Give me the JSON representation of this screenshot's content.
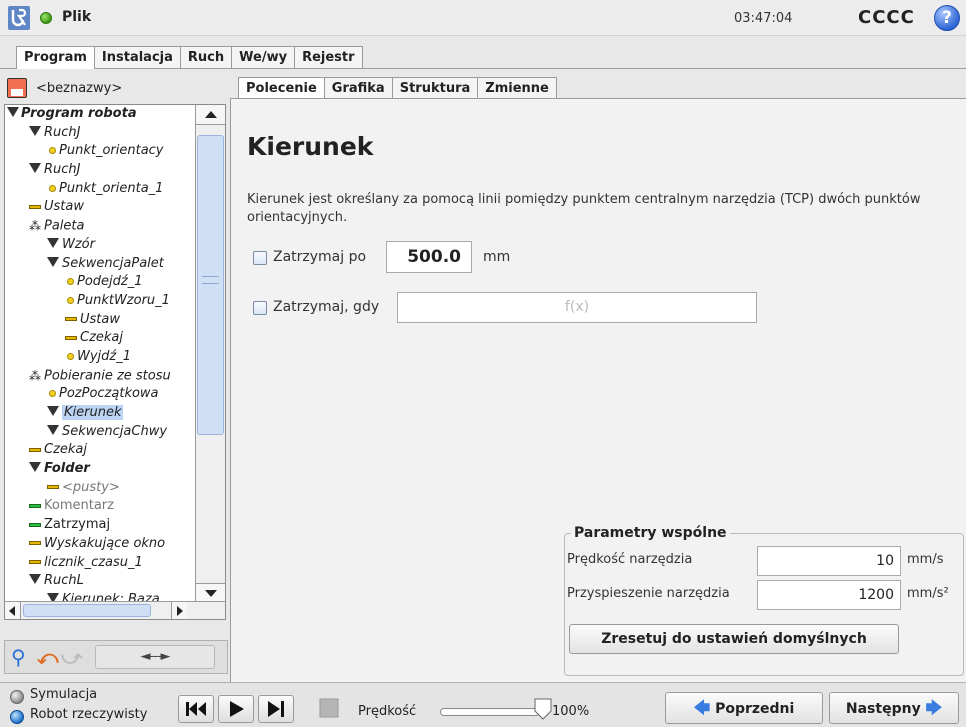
{
  "header": {
    "title": "Plik",
    "clock": "03:47:04",
    "robot_name": "CCCC",
    "help_symbol": "?"
  },
  "main_tabs": [
    "Program",
    "Instalacja",
    "Ruch",
    "We/wy",
    "Rejestr"
  ],
  "sub_tabs": [
    "Polecenie",
    "Grafika",
    "Struktura",
    "Zmienne"
  ],
  "left": {
    "file_name": "<beznazwy>",
    "tree": [
      {
        "label": "Program robota",
        "icon": "none",
        "indent": 0,
        "bold": true
      },
      {
        "label": "RuchJ",
        "icon": "triangle",
        "indent": 1
      },
      {
        "label": "Punkt_orientacy",
        "icon": "waypoint",
        "indent": 2
      },
      {
        "label": "RuchJ",
        "icon": "triangle",
        "indent": 1
      },
      {
        "label": "Punkt_orienta_1",
        "icon": "waypoint",
        "indent": 2
      },
      {
        "label": "Ustaw",
        "icon": "bar",
        "indent": 1
      },
      {
        "label": "Paleta",
        "icon": "pallet",
        "indent": 1
      },
      {
        "label": "Wzór",
        "icon": "triangle",
        "indent": 2
      },
      {
        "label": "SekwencjaPalet",
        "icon": "triangle",
        "indent": 2
      },
      {
        "label": "Podejdź_1",
        "icon": "waypoint",
        "indent": 3
      },
      {
        "label": "PunktWzoru_1",
        "icon": "waypoint",
        "indent": 3
      },
      {
        "label": "Ustaw",
        "icon": "bar",
        "indent": 3
      },
      {
        "label": "Czekaj",
        "icon": "bar",
        "indent": 3
      },
      {
        "label": "Wyjdź_1",
        "icon": "waypoint",
        "indent": 3
      },
      {
        "label": "Pobieranie ze stosu",
        "icon": "pallet",
        "indent": 1
      },
      {
        "label": "PozPoczątkowa",
        "icon": "waypoint",
        "indent": 2
      },
      {
        "label": "Kierunek",
        "icon": "triangle",
        "indent": 2,
        "selected": true
      },
      {
        "label": "SekwencjaChwy",
        "icon": "triangle",
        "indent": 2
      },
      {
        "label": "Czekaj",
        "icon": "bar",
        "indent": 1
      },
      {
        "label": "Folder",
        "icon": "triangle",
        "indent": 1,
        "bold": true
      },
      {
        "label": "<pusty>",
        "icon": "bar",
        "indent": 2,
        "grey": true
      },
      {
        "label": "Komentarz",
        "icon": "bar-green",
        "indent": 1,
        "grey": true,
        "upright": true
      },
      {
        "label": "Zatrzymaj",
        "icon": "bar-green",
        "indent": 1,
        "upright": true
      },
      {
        "label": "Wyskakujące okno",
        "icon": "bar",
        "indent": 1
      },
      {
        "label": "licznik_czasu_1",
        "icon": "bar",
        "indent": 1
      },
      {
        "label": "RuchL",
        "icon": "triangle",
        "indent": 1
      },
      {
        "label": "Kierunek: Baza",
        "icon": "triangle",
        "indent": 2
      }
    ],
    "move_tool_label": "◄---►"
  },
  "content": {
    "title": "Kierunek",
    "description": "Kierunek jest określany za pomocą linii pomiędzy punktem centralnym narzędzia (TCP) dwóch punktów orientacyjnych.",
    "stop_after_label": "Zatrzymaj po",
    "stop_after_value": "500.0",
    "stop_after_unit": "mm",
    "stop_when_label": "Zatrzymaj, gdy",
    "stop_when_placeholder": "f(x)",
    "params": {
      "title": "Parametry wspólne",
      "tool_speed_label": "Prędkość narzędzia",
      "tool_speed_value": "10",
      "tool_speed_unit": "mm/s",
      "tool_accel_label": "Przyspieszenie narzędzia",
      "tool_accel_value": "1200",
      "tool_accel_unit": "mm/s²",
      "reset_label": "Zresetuj do ustawień domyślnych"
    }
  },
  "footer": {
    "simulation_label": "Symulacja",
    "real_robot_label": "Robot rzeczywisty",
    "speed_label": "Prędkość",
    "speed_value": "100%",
    "speed_fraction": 1.0,
    "prev_label": "Poprzedni",
    "next_label": "Następny"
  }
}
